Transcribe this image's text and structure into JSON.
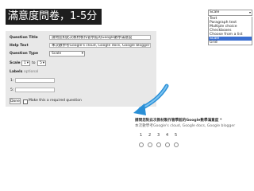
{
  "banner": {
    "title": "滿意度問卷，1-5分"
  },
  "dropdown": {
    "selected": "Scale",
    "options": [
      {
        "label": "Text",
        "selected": false
      },
      {
        "label": "Paragraph text",
        "selected": false
      },
      {
        "label": "Multiple choice",
        "selected": false
      },
      {
        "label": "Checkboxes",
        "selected": false
      },
      {
        "label": "Choose from a list",
        "selected": false
      },
      {
        "label": "Scale",
        "selected": true
      },
      {
        "label": "Grid",
        "selected": false
      }
    ]
  },
  "editor": {
    "question_title_label": "Question Title",
    "question_title_value": "請問您對此次教材製作管學館的Google數學滿意度",
    "help_text_label": "Help Text",
    "help_text_value": "本次數學考Google's cloud, Google docs, Google blogger",
    "question_type_label": "Question Type",
    "question_type_value": "Scale",
    "scale_label": "Scale",
    "scale_from": "1",
    "scale_to_word": "to",
    "scale_to": "5",
    "labels_label": "Labels",
    "labels_hint": "optional",
    "label_1_key": "1:",
    "label_5_key": "5:",
    "done_label": "Done",
    "required_label": "Make this a required question"
  },
  "preview": {
    "title": "請問您對此次教材製作管學館的Google數學滿意度 *",
    "help": "本次數學考Google's cloud, Google docs, Google blogger",
    "scale": [
      "1",
      "2",
      "3",
      "4",
      "5"
    ]
  },
  "colors": {
    "selection": "#3b6fd1",
    "arrow": "#2a8fd6",
    "panel": "#e8e8e8"
  }
}
